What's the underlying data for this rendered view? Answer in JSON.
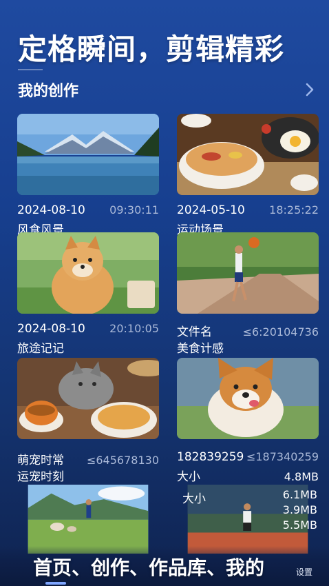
{
  "header": {
    "headline": "定格瞬间，剪辑精彩",
    "section_title": "我的创作"
  },
  "cards": [
    {
      "line1_left": "2024-08-10",
      "line1_right": "09:30:11",
      "line2": "风食风景",
      "image": "lake-mountain-photo"
    },
    {
      "line1_left": "2024-05-10",
      "line1_right": "18:25:22",
      "line2": "运动场景",
      "image": "noodle-meal-photo"
    },
    {
      "line1_left": "2024-08-10",
      "line1_right": "20:10:05",
      "line2": "旅途记记",
      "image": "pomeranian-dog-photo"
    },
    {
      "line1_left": "文件名",
      "line1_right": "≤6:20104736",
      "line2": "美食计感",
      "image": "basketball-runner-photo"
    },
    {
      "line1_left": "萌宠时常",
      "line1_right": "≤645678130",
      "line2": "运宠时刻",
      "image": "cat-tea-pasta-photo"
    },
    {
      "line1_left": "182839259",
      "line1_right": "≤187340259",
      "line2": "大小",
      "line2_right": "4.8MB",
      "image": "corgi-dog-photo"
    },
    {
      "image": "runner-dogs-meadow-photo"
    },
    {
      "overlay_label": "大小",
      "sizes": [
        "6.1MB",
        "3.9MB",
        "5.5MB"
      ],
      "image": "track-runner-photo"
    }
  ],
  "bottom_nav": {
    "label": "首页、创作、作品库、我的",
    "badge": "设置"
  }
}
